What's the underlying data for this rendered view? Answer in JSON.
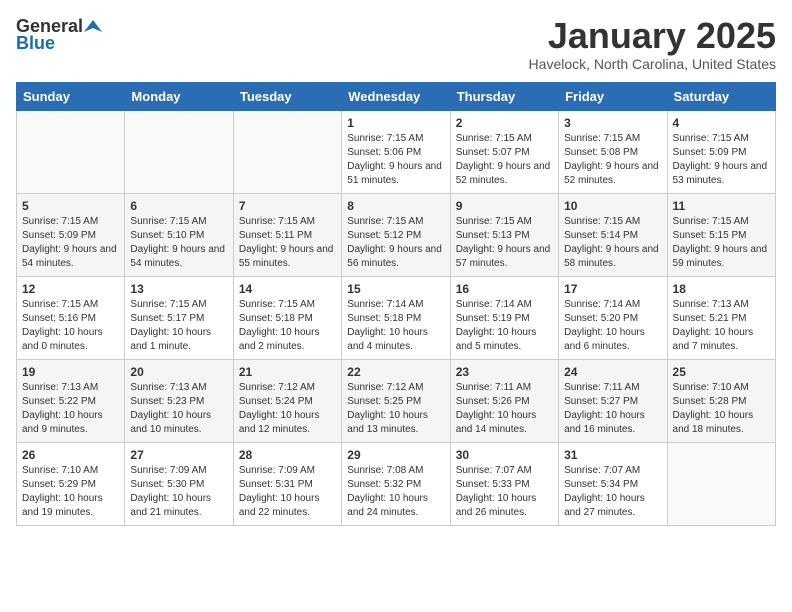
{
  "logo": {
    "general": "General",
    "blue": "Blue"
  },
  "header": {
    "title": "January 2025",
    "subtitle": "Havelock, North Carolina, United States"
  },
  "days_of_week": [
    "Sunday",
    "Monday",
    "Tuesday",
    "Wednesday",
    "Thursday",
    "Friday",
    "Saturday"
  ],
  "weeks": [
    [
      {
        "day": "",
        "content": ""
      },
      {
        "day": "",
        "content": ""
      },
      {
        "day": "",
        "content": ""
      },
      {
        "day": "1",
        "content": "Sunrise: 7:15 AM\nSunset: 5:06 PM\nDaylight: 9 hours and 51 minutes."
      },
      {
        "day": "2",
        "content": "Sunrise: 7:15 AM\nSunset: 5:07 PM\nDaylight: 9 hours and 52 minutes."
      },
      {
        "day": "3",
        "content": "Sunrise: 7:15 AM\nSunset: 5:08 PM\nDaylight: 9 hours and 52 minutes."
      },
      {
        "day": "4",
        "content": "Sunrise: 7:15 AM\nSunset: 5:09 PM\nDaylight: 9 hours and 53 minutes."
      }
    ],
    [
      {
        "day": "5",
        "content": "Sunrise: 7:15 AM\nSunset: 5:09 PM\nDaylight: 9 hours and 54 minutes."
      },
      {
        "day": "6",
        "content": "Sunrise: 7:15 AM\nSunset: 5:10 PM\nDaylight: 9 hours and 54 minutes."
      },
      {
        "day": "7",
        "content": "Sunrise: 7:15 AM\nSunset: 5:11 PM\nDaylight: 9 hours and 55 minutes."
      },
      {
        "day": "8",
        "content": "Sunrise: 7:15 AM\nSunset: 5:12 PM\nDaylight: 9 hours and 56 minutes."
      },
      {
        "day": "9",
        "content": "Sunrise: 7:15 AM\nSunset: 5:13 PM\nDaylight: 9 hours and 57 minutes."
      },
      {
        "day": "10",
        "content": "Sunrise: 7:15 AM\nSunset: 5:14 PM\nDaylight: 9 hours and 58 minutes."
      },
      {
        "day": "11",
        "content": "Sunrise: 7:15 AM\nSunset: 5:15 PM\nDaylight: 9 hours and 59 minutes."
      }
    ],
    [
      {
        "day": "12",
        "content": "Sunrise: 7:15 AM\nSunset: 5:16 PM\nDaylight: 10 hours and 0 minutes."
      },
      {
        "day": "13",
        "content": "Sunrise: 7:15 AM\nSunset: 5:17 PM\nDaylight: 10 hours and 1 minute."
      },
      {
        "day": "14",
        "content": "Sunrise: 7:15 AM\nSunset: 5:18 PM\nDaylight: 10 hours and 2 minutes."
      },
      {
        "day": "15",
        "content": "Sunrise: 7:14 AM\nSunset: 5:18 PM\nDaylight: 10 hours and 4 minutes."
      },
      {
        "day": "16",
        "content": "Sunrise: 7:14 AM\nSunset: 5:19 PM\nDaylight: 10 hours and 5 minutes."
      },
      {
        "day": "17",
        "content": "Sunrise: 7:14 AM\nSunset: 5:20 PM\nDaylight: 10 hours and 6 minutes."
      },
      {
        "day": "18",
        "content": "Sunrise: 7:13 AM\nSunset: 5:21 PM\nDaylight: 10 hours and 7 minutes."
      }
    ],
    [
      {
        "day": "19",
        "content": "Sunrise: 7:13 AM\nSunset: 5:22 PM\nDaylight: 10 hours and 9 minutes."
      },
      {
        "day": "20",
        "content": "Sunrise: 7:13 AM\nSunset: 5:23 PM\nDaylight: 10 hours and 10 minutes."
      },
      {
        "day": "21",
        "content": "Sunrise: 7:12 AM\nSunset: 5:24 PM\nDaylight: 10 hours and 12 minutes."
      },
      {
        "day": "22",
        "content": "Sunrise: 7:12 AM\nSunset: 5:25 PM\nDaylight: 10 hours and 13 minutes."
      },
      {
        "day": "23",
        "content": "Sunrise: 7:11 AM\nSunset: 5:26 PM\nDaylight: 10 hours and 14 minutes."
      },
      {
        "day": "24",
        "content": "Sunrise: 7:11 AM\nSunset: 5:27 PM\nDaylight: 10 hours and 16 minutes."
      },
      {
        "day": "25",
        "content": "Sunrise: 7:10 AM\nSunset: 5:28 PM\nDaylight: 10 hours and 18 minutes."
      }
    ],
    [
      {
        "day": "26",
        "content": "Sunrise: 7:10 AM\nSunset: 5:29 PM\nDaylight: 10 hours and 19 minutes."
      },
      {
        "day": "27",
        "content": "Sunrise: 7:09 AM\nSunset: 5:30 PM\nDaylight: 10 hours and 21 minutes."
      },
      {
        "day": "28",
        "content": "Sunrise: 7:09 AM\nSunset: 5:31 PM\nDaylight: 10 hours and 22 minutes."
      },
      {
        "day": "29",
        "content": "Sunrise: 7:08 AM\nSunset: 5:32 PM\nDaylight: 10 hours and 24 minutes."
      },
      {
        "day": "30",
        "content": "Sunrise: 7:07 AM\nSunset: 5:33 PM\nDaylight: 10 hours and 26 minutes."
      },
      {
        "day": "31",
        "content": "Sunrise: 7:07 AM\nSunset: 5:34 PM\nDaylight: 10 hours and 27 minutes."
      },
      {
        "day": "",
        "content": ""
      }
    ]
  ]
}
